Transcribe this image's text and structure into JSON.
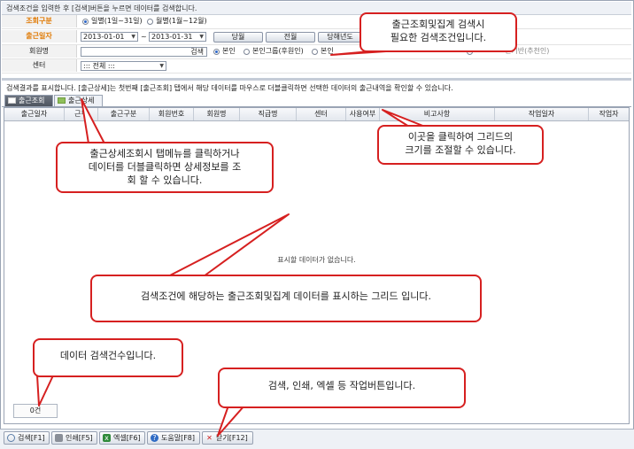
{
  "header": {
    "instruction": "검색조건을 입력한 후 [검색]버튼을 누르면 데이터를 검색합니다."
  },
  "search": {
    "inquiry_type": {
      "label": "조회구분",
      "option_daily": "일별(1일~31일)",
      "option_monthly": "월별(1월~12월)",
      "selected": "daily"
    },
    "date": {
      "label": "출근일자",
      "from": "2013-01-01",
      "separator": "~",
      "to": "2013-01-31",
      "buttons": [
        "당월",
        "전월",
        "당해년도"
      ]
    },
    "member": {
      "label": "회원명",
      "search_button": "검색",
      "option_self": "본인",
      "option_group": "본인그룹(후원인)",
      "option_self2": "본인",
      "hidden_option": "인기반(추천인)"
    },
    "center": {
      "label": "센터",
      "value": "::: 전체 :::"
    }
  },
  "results": {
    "info": "검색결과를 표시합니다. [출근상세]는 첫번째 [출근조회] 탭에서 해당 데이터를 마우스로 더블클릭하면 선택한 데이터의 출근내역을 확인할 수 있습니다.",
    "tabs": [
      {
        "label": "출근조회",
        "active": true
      },
      {
        "label": "출근상세",
        "active": false
      }
    ],
    "columns": [
      "출근일자",
      "근무",
      "출근구분",
      "회원번호",
      "회원명",
      "직급명",
      "센터",
      "사용여부",
      "비고사항",
      "작업일자",
      "작업자"
    ],
    "empty_message": "표시할 데이터가 없습니다.",
    "count": "0건"
  },
  "toolbar": {
    "search": "검색[F1]",
    "print": "인쇄[F5]",
    "excel": "엑셀[F6]",
    "help": "도움말[F8]",
    "close": "닫기[F12]"
  },
  "callouts": {
    "search_conditions": [
      "출근조회및집계 검색시",
      "필요한 검색조건입니다."
    ],
    "tab_info": [
      "출근상세조회시 탭메뉴를 클릭하거나",
      "데이터를 더블클릭하면 상세정보를 조",
      "회 할 수 있습니다."
    ],
    "resize_info": [
      "이곳을 클릭하여 그리드의",
      "크기를 조절할 수 있습니다."
    ],
    "grid_info": "검색조건에 해당하는 출근조회및집계 데이터를 표시하는 그리드 입니다.",
    "count_info": "데이터 검색건수입니다.",
    "button_info": "검색, 인쇄, 엑셀 등 작업버튼입니다."
  },
  "colors": {
    "label_orange": "#e07800",
    "callout_border": "#d62020",
    "radio_selected": "#2d67c8"
  }
}
